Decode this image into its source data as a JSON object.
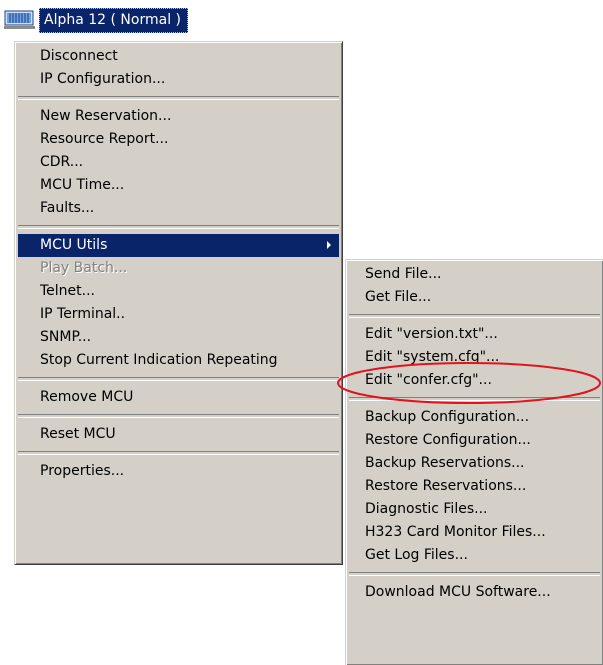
{
  "node": {
    "icon": "mcu-device-icon",
    "label": "Alpha 12   ( Normal )"
  },
  "main_menu": {
    "groups": [
      [
        "Disconnect",
        "IP Configuration..."
      ],
      [
        "New Reservation...",
        "Resource Report...",
        "CDR...",
        "MCU Time...",
        "Faults..."
      ],
      [
        "MCU Utils",
        "Play Batch...",
        "Telnet...",
        "IP Terminal..",
        "SNMP...",
        "Stop Current Indication Repeating"
      ],
      [
        "Remove MCU"
      ],
      [
        "Reset MCU"
      ],
      [
        "Properties..."
      ]
    ]
  },
  "sub_menu": {
    "groups": [
      [
        "Send File...",
        "Get File..."
      ],
      [
        "Edit \"version.txt\"...",
        "Edit \"system.cfg\"...",
        "Edit \"confer.cfg\"..."
      ],
      [
        "Backup Configuration...",
        "Restore Configuration...",
        "Backup Reservations...",
        "Restore Reservations...",
        "Diagnostic Files...",
        "H323 Card Monitor Files...",
        "Get Log Files..."
      ],
      [
        "Download MCU Software..."
      ]
    ]
  },
  "colors": {
    "menu_bg": "#d4d0c8",
    "selection_bg": "#0a246a",
    "annotation": "#e0141e"
  }
}
